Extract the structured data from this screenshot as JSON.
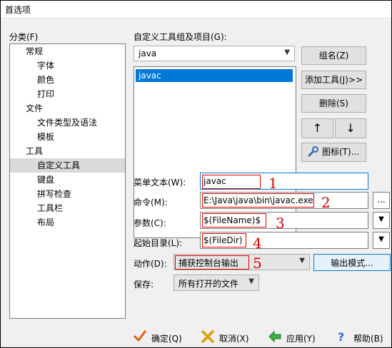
{
  "window": {
    "title": "首选项"
  },
  "category": {
    "label": "分类(F)",
    "items": [
      {
        "label": "常规",
        "level": 1
      },
      {
        "label": "字体",
        "level": 2
      },
      {
        "label": "颜色",
        "level": 2
      },
      {
        "label": "打印",
        "level": 2
      },
      {
        "label": "文件",
        "level": 1
      },
      {
        "label": "文件类型及语法",
        "level": 2
      },
      {
        "label": "模板",
        "level": 2
      },
      {
        "label": "工具",
        "level": 1
      },
      {
        "label": "自定义工具",
        "level": 2,
        "selected": true
      },
      {
        "label": "键盘",
        "level": 2
      },
      {
        "label": "拼写检查",
        "level": 2
      },
      {
        "label": "工具栏",
        "level": 2
      },
      {
        "label": "布局",
        "level": 2
      }
    ]
  },
  "tools": {
    "group_label": "自定义工具组及项目(G):",
    "group_value": "java",
    "list": [
      "javac"
    ],
    "buttons": {
      "group_name": "组名(Z)",
      "add_tool": "添加工具(J)>>",
      "delete": "删除(S)",
      "up": "↑",
      "down": "↓",
      "icon": "图标(T)..."
    }
  },
  "form": {
    "menu_text_label": "菜单文本(W):",
    "menu_text_value": "javac",
    "command_label": "命令(M):",
    "command_value": "E:\\Java\\java\\bin\\javac.exe",
    "browse_label": "...",
    "args_label": "参数(C):",
    "args_value": "$(FileName)$",
    "init_dir_label": "起始目录(L):",
    "init_dir_value": "$(FileDir)",
    "action_label": "动作(D):",
    "action_value": "捕获控制台输出",
    "output_mode_label": "输出模式...",
    "save_label": "保存:",
    "save_value": "所有打开的文件"
  },
  "annotations": [
    "1",
    "2",
    "3",
    "4",
    "5"
  ],
  "footer": {
    "ok": "确定(Q)",
    "cancel": "取消(X)",
    "apply": "应用(Y)",
    "help": "帮助(B)"
  },
  "colors": {
    "accent": "#0078d7",
    "annotation_red": "#e00000"
  }
}
